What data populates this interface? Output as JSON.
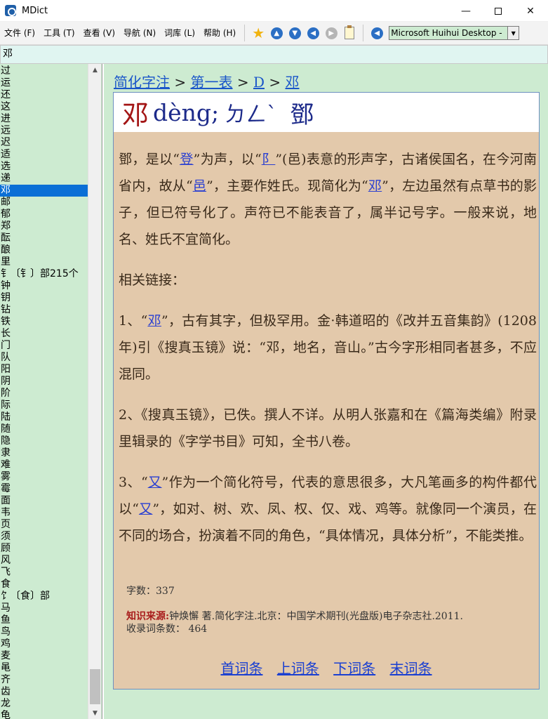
{
  "window": {
    "title": "MDict"
  },
  "menu": [
    {
      "label": "文件 (F)"
    },
    {
      "label": "工具 (T)"
    },
    {
      "label": "查看 (V)"
    },
    {
      "label": "导航 (N)"
    },
    {
      "label": "词库 (L)"
    },
    {
      "label": "帮助 (H)"
    }
  ],
  "toolbar": {
    "dictionary_selected": "Microsoft Huihui Desktop -"
  },
  "search": {
    "value": "邓"
  },
  "wordlist": {
    "items": [
      "过",
      "运",
      "还",
      "这",
      "进",
      "远",
      "迟",
      "适",
      "选",
      "递",
      "邓",
      "邮",
      "郁",
      "郑",
      "酝",
      "酿",
      "里",
      "钅〔钅〕部215个",
      "钟",
      "钥",
      "钻",
      "铁",
      "长",
      "门",
      "队",
      "阳",
      "阴",
      "阶",
      "际",
      "陆",
      "随",
      "隐",
      "隶",
      "难",
      "雾",
      "霉",
      "面",
      "韦",
      "页",
      "须",
      "顾",
      "风",
      "飞",
      "食",
      "饣〔食〕部",
      "马",
      "鱼",
      "鸟",
      "鸡",
      "麦",
      "黾",
      "齐",
      "齿",
      "龙",
      "龟"
    ],
    "selected_index": 10
  },
  "breadcrumb": {
    "part1": "简化字注",
    "sep": ">",
    "part2": "第一表",
    "part3": "D",
    "part4": "邓"
  },
  "entry": {
    "headword": "邓",
    "pinyin": "dèng;",
    "zhuyin": "ㄉㄥˋ",
    "traditional": "鄧",
    "p1_a": "鄧，是以“",
    "p1_link1": "登",
    "p1_b": "”为声，以“",
    "p1_link2": "阝",
    "p1_c": "”(邑)表意的形声字，古诸侯国名，在今河南省内，故从“",
    "p1_link3": "邑",
    "p1_d": "”，主要作姓氏。现简化为“",
    "p1_link4": "邓",
    "p1_e": "”，左边虽然有点草书的影子，但已符号化了。声符已不能表音了，属半记号字。一般来说，地名、姓氏不宜简化。",
    "related": "相关链接：",
    "p2_a": "1、“",
    "p2_link": "邓",
    "p2_b": "”，古有其字，但极罕用。金·韩道昭的《改并五音集韵》(1208年)引《搜真玉镜》说：“邓，地名，音山。”古今字形相同者甚多，不应混同。",
    "p3": "2、《搜真玉镜》，已佚。撰人不详。从明人张嘉和在《篇海类编》附录里辑录的《字学书目》可知，全书八卷。",
    "p4_a": "3、“",
    "p4_link1": "又",
    "p4_b": "”作为一个简化符号，代表的意思很多，大凡笔画多的构件都代以“",
    "p4_link2": "又",
    "p4_c": "”，如对、树、欢、凤、权、仅、戏、鸡等。就像同一个演员，在不同的场合，扮演着不同的角色，“具体情况，具体分析”，不能类推。",
    "char_count": "字数：337",
    "source_label": "知识来源:",
    "source_text": "钟焕懈 著.简化字注.北京：中国学术期刊(光盘版)电子杂志社.2011.",
    "entry_count": "收录词条数： 464"
  },
  "nav": {
    "first": "首词条",
    "prev": "上词条",
    "next": "下词条",
    "last": "末词条"
  }
}
